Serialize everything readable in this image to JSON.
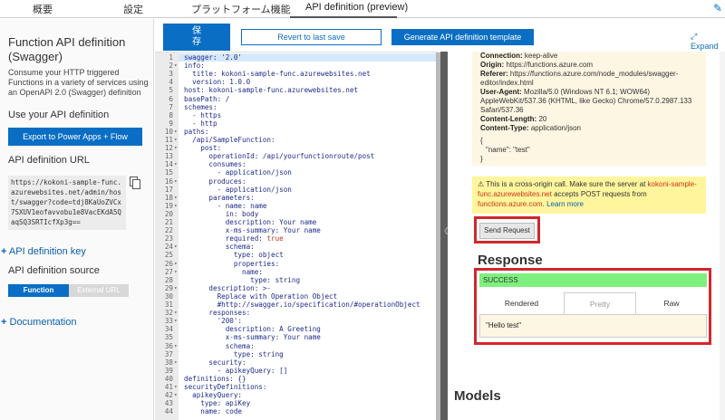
{
  "tabs": [
    "概要",
    "設定",
    "プラットフォーム機能",
    "API definition (preview)"
  ],
  "left": {
    "title": "Function API definition (Swagger)",
    "description": "Consume your HTTP triggered Functions in a variety of services using an OpenAPI 2.0 (Swagger) definition",
    "use_heading": "Use your API definition",
    "export_button": "Export to Power Apps + Flow",
    "url_heading": "API definition URL",
    "url_value": "https://kokoni-sample-func.azurewebsites.net/admin/host/swagger?code=tdj8KaUoZVCx7SXUV1eofavvobu1e8VacEKdA5QaqSQ3SRTIcfXp3g==",
    "key_link": "API definition key",
    "source_heading": "API definition source",
    "source_options": [
      "Function",
      "External URL"
    ],
    "documentation_link": "Documentation"
  },
  "toolbar": {
    "save": "保存",
    "revert": "Revert to last save",
    "generate": "Generate API definition template",
    "expand": "Expand"
  },
  "editor_lines": [
    "swagger: '2.0'",
    "info:",
    "  title: kokoni-sample-func.azurewebsites.net",
    "  version: 1.0.0",
    "host: kokoni-sample-func.azurewebsites.net",
    "basePath: /",
    "schemes:",
    "  - https",
    "  - http",
    "paths:",
    "  /api/SampleFunction:",
    "    post:",
    "      operationId: /api/yourfunctionroute/post",
    "      consumes:",
    "        - application/json",
    "      produces:",
    "        - application/json",
    "      parameters:",
    "        - name: name",
    "          in: body",
    "          description: Your name",
    "          x-ms-summary: Your name",
    "          required: true",
    "          schema:",
    "            type: object",
    "            properties:",
    "              name:",
    "                type: string",
    "      description: >-",
    "        Replace with Operation Object",
    "        #http://swagger.io/specification/#operationObject",
    "      responses:",
    "        '200':",
    "          description: A Greeting",
    "          x-ms-summary: Your name",
    "          schema:",
    "            type: string",
    "      security:",
    "        - apikeyQuery: []",
    "definitions: {}",
    "securityDefinitions:",
    "  apikeyQuery:",
    "    type: apiKey",
    "    name: code"
  ],
  "request": {
    "connection_label": "Connection:",
    "connection": "keep-alive",
    "origin_label": "Origin:",
    "origin": "https://functions.azure.com",
    "referer_label": "Referer:",
    "referer": "https://functions.azure.com/node_modules/swagger-editor/index.html",
    "ua_label": "User-Agent:",
    "ua": "Mozilla/5.0 (Windows NT 6.1; WOW64) AppleWebKit/537.36 (KHTML, like Gecko) Chrome/57.0.2987.133 Safari/537.36",
    "cl_label": "Content-Length:",
    "cl": "20",
    "ct_label": "Content-Type:",
    "ct": "application/json",
    "body_open": "{",
    "body_line": "\"name\": \"test\"",
    "body_close": "}"
  },
  "warning": {
    "prefix": "⚠ This is a cross-origin call. Make sure the server at",
    "server": "kokoni-sample-func.azurewebsites.net",
    "middle": "accepts POST requests from",
    "from": "functions.azure.com",
    "end": ".",
    "learn": "Learn more"
  },
  "send_button": "Send Request",
  "response": {
    "title": "Response",
    "status": "SUCCESS",
    "tabs": [
      "Rendered",
      "Pretty",
      "Raw"
    ],
    "body": "\"Hello test\""
  },
  "models_title": "Models",
  "colors": {
    "accent": "#0b6ec5",
    "success": "#7ef07e",
    "highlight": "#d2262d"
  }
}
